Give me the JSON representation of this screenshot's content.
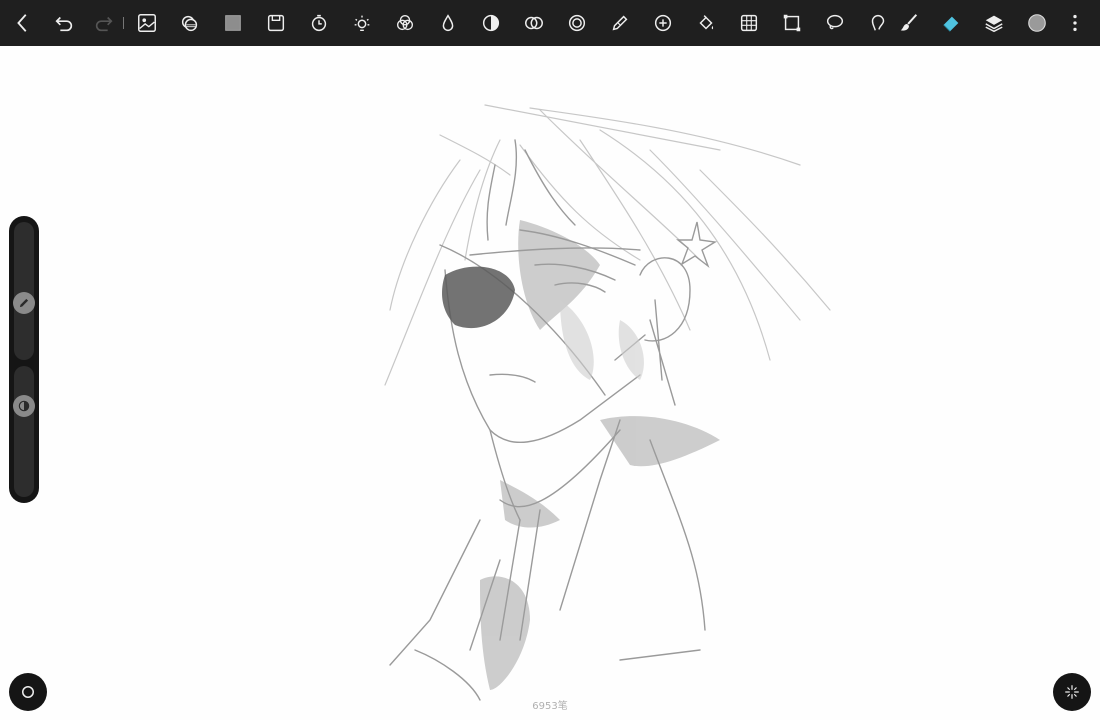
{
  "toolbar": {
    "tools": [
      {
        "name": "back-icon"
      },
      {
        "name": "undo-icon"
      },
      {
        "name": "redo-icon"
      },
      {
        "name": "image-import-icon"
      },
      {
        "name": "layer-stack-icon"
      },
      {
        "name": "texture-icon"
      },
      {
        "name": "save-icon"
      },
      {
        "name": "timer-icon"
      },
      {
        "name": "brightness-icon"
      },
      {
        "name": "color-balance-icon"
      },
      {
        "name": "blur-drop-icon"
      },
      {
        "name": "contrast-icon"
      },
      {
        "name": "blend-icon"
      },
      {
        "name": "filter-icon"
      },
      {
        "name": "pen-edit-icon"
      },
      {
        "name": "add-icon"
      },
      {
        "name": "fill-bucket-icon"
      },
      {
        "name": "grid-icon"
      },
      {
        "name": "transform-icon"
      },
      {
        "name": "lasso-icon"
      },
      {
        "name": "smudge-icon"
      },
      {
        "name": "brush-icon"
      },
      {
        "name": "eraser-icon"
      },
      {
        "name": "layers-icon"
      },
      {
        "name": "color-icon"
      },
      {
        "name": "more-icon"
      }
    ],
    "active_tool": "eraser-icon",
    "accent_color": "#4fc3e0",
    "current_color": "#9a9a9a"
  },
  "side_panel": {
    "brush_size": 0.3,
    "opacity": 0.15
  },
  "status": {
    "stroke_count": "6953笔"
  }
}
